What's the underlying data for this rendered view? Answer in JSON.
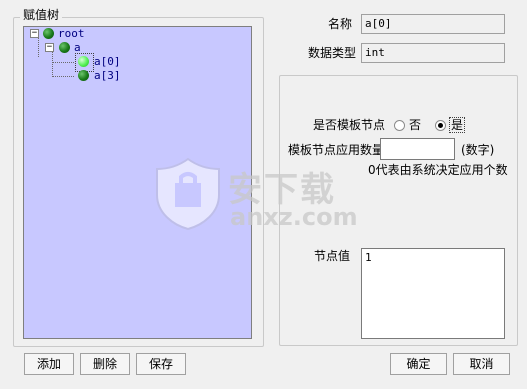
{
  "tree_group": {
    "title": "赋值树",
    "nodes": [
      {
        "label": "root",
        "expander": "−"
      },
      {
        "label": "a",
        "expander": "−"
      },
      {
        "label": "a[0]",
        "selected": true
      },
      {
        "label": "a[3]"
      }
    ]
  },
  "fields": {
    "name_label": "名称",
    "name_value": "a[0]",
    "type_label": "数据类型",
    "type_value": "int"
  },
  "template": {
    "is_template_label": "是否模板节点",
    "option_no": "否",
    "option_yes": "是",
    "selected_option": "yes",
    "count_label": "模板节点应用数量",
    "count_value": "",
    "count_hint": "(数字)",
    "zero_note": "0代表由系统决定应用个数"
  },
  "node_value": {
    "label": "节点值",
    "value": "1"
  },
  "buttons": {
    "add": "添加",
    "delete": "删除",
    "save": "保存",
    "ok": "确定",
    "cancel": "取消"
  },
  "watermark": {
    "title": "安下载",
    "domain": "anxz.com"
  }
}
